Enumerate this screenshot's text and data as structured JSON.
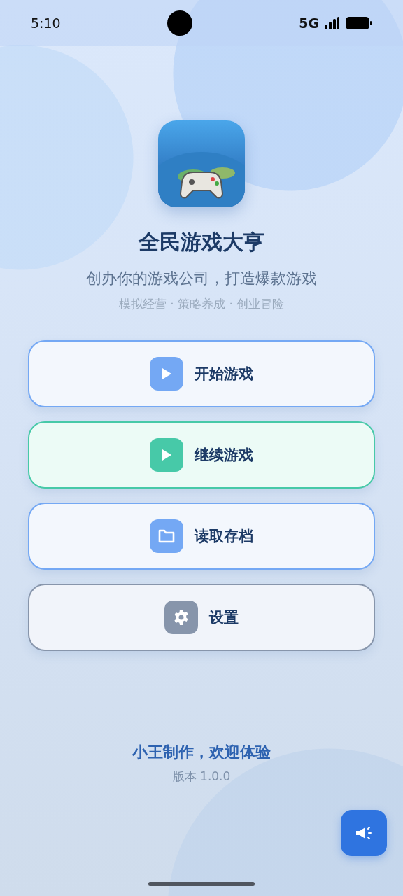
{
  "status_bar": {
    "time": "5:10",
    "network": "5G"
  },
  "app": {
    "title": "全民游戏大亨",
    "subtitle": "创办你的游戏公司，打造爆款游戏",
    "tags": "模拟经营 · 策略养成 · 创业冒险"
  },
  "menu": [
    {
      "label": "开始游戏",
      "kind": "play",
      "color": "#74a8f4"
    },
    {
      "label": "继续游戏",
      "kind": "play",
      "color": "#47c9a8"
    },
    {
      "label": "读取存档",
      "kind": "folder",
      "color": "#74a8f4"
    },
    {
      "label": "设置",
      "kind": "gear",
      "color": "#8795ab"
    }
  ],
  "footer": {
    "credit": "小王制作，欢迎体验",
    "version": "版本 1.0.0"
  }
}
